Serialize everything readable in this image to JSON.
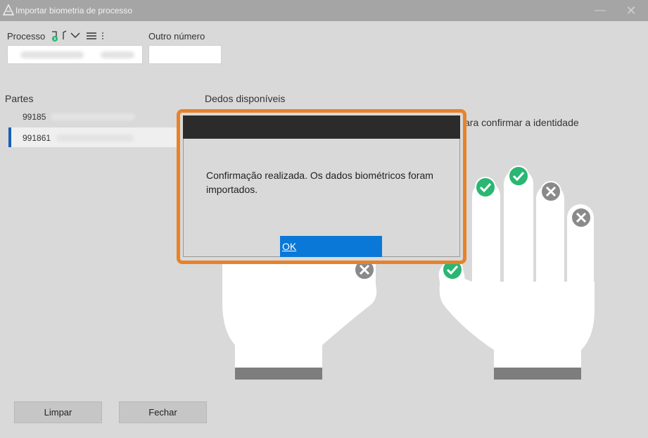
{
  "window": {
    "title": "Importar biometria de processo"
  },
  "form": {
    "processo_label": "Processo",
    "outro_numero_label": "Outro número"
  },
  "parties": {
    "title": "Partes",
    "items": [
      {
        "number": "99185"
      },
      {
        "number": "991861"
      }
    ]
  },
  "fingers": {
    "title": "Dedos disponíveis",
    "instruction_partial": "ara confirmar a identidade"
  },
  "buttons": {
    "clear": "Limpar",
    "close": "Fechar"
  },
  "dialog": {
    "message": "Confirmação realizada. Os dados biométricos foram importados.",
    "ok": "OK"
  },
  "colors": {
    "accent": "#0a78d7",
    "highlight_border": "#e8822a",
    "check": "#2bb673",
    "cross": "#8a8a8a"
  }
}
